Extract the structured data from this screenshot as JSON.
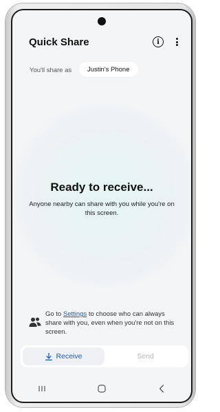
{
  "header": {
    "title": "Quick Share",
    "info_icon": "info-icon",
    "more_icon": "more-vert-icon"
  },
  "identity": {
    "label": "You'll share as",
    "device_name": "Justin's Phone"
  },
  "status": {
    "heading": "Ready to receive...",
    "description": "Anyone nearby can share with you while you're on this screen."
  },
  "settings_note": {
    "prefix": "Go to ",
    "link": "Settings",
    "suffix": " to choose who can always share with you, even when you're not on this screen.",
    "icon": "people-icon"
  },
  "tabs": {
    "receive": "Receive",
    "send": "Send",
    "selected": "Receive",
    "receive_icon": "download-icon"
  },
  "navigation": {
    "items": [
      "recents-icon",
      "home-icon",
      "back-icon"
    ]
  },
  "colors": {
    "accent": "#1a5ac9",
    "background": "#f4f5f7",
    "glow": "#e6f4f4",
    "disabled_text": "#b5b5b5"
  }
}
